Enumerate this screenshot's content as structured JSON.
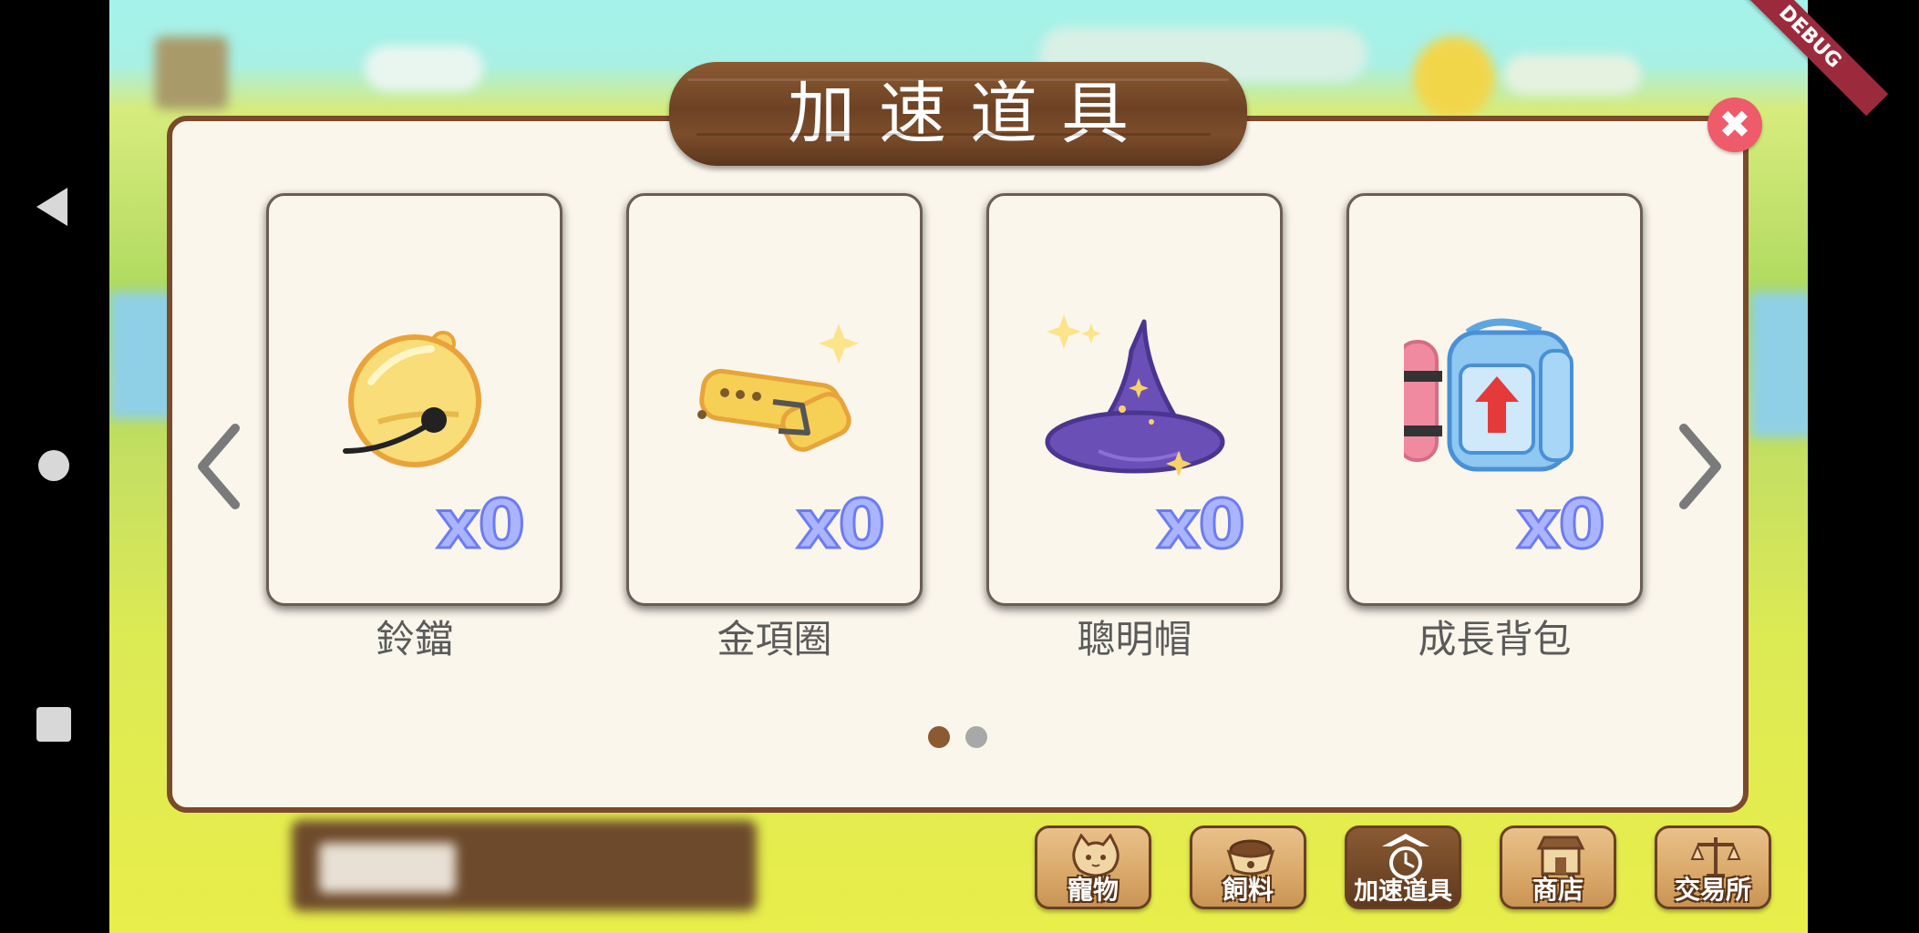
{
  "dialog": {
    "title": "加速道具",
    "close_icon": "close-icon"
  },
  "items": [
    {
      "name": "鈴鐺",
      "count": "x0",
      "icon": "bell-icon"
    },
    {
      "name": "金項圈",
      "count": "x0",
      "icon": "gold-collar-icon"
    },
    {
      "name": "聰明帽",
      "count": "x0",
      "icon": "wizard-hat-icon"
    },
    {
      "name": "成長背包",
      "count": "x0",
      "icon": "growth-backpack-icon"
    }
  ],
  "pagination": {
    "current": 1,
    "total": 2
  },
  "tabs": [
    {
      "label": "寵物",
      "icon": "cat-icon"
    },
    {
      "label": "飼料",
      "icon": "pet-food-icon"
    },
    {
      "label": "加速道具",
      "icon": "speedup-clock-icon",
      "active": true
    },
    {
      "label": "商店",
      "icon": "shop-icon"
    },
    {
      "label": "交易所",
      "icon": "scale-icon"
    }
  ],
  "debug_banner": "DEBUG",
  "colors": {
    "wood": "#7b4a2b",
    "close": "#ee5b6a",
    "count": "#aab4ff",
    "dot_active": "#8b5a32",
    "dot_inactive": "#a8a8a8"
  }
}
